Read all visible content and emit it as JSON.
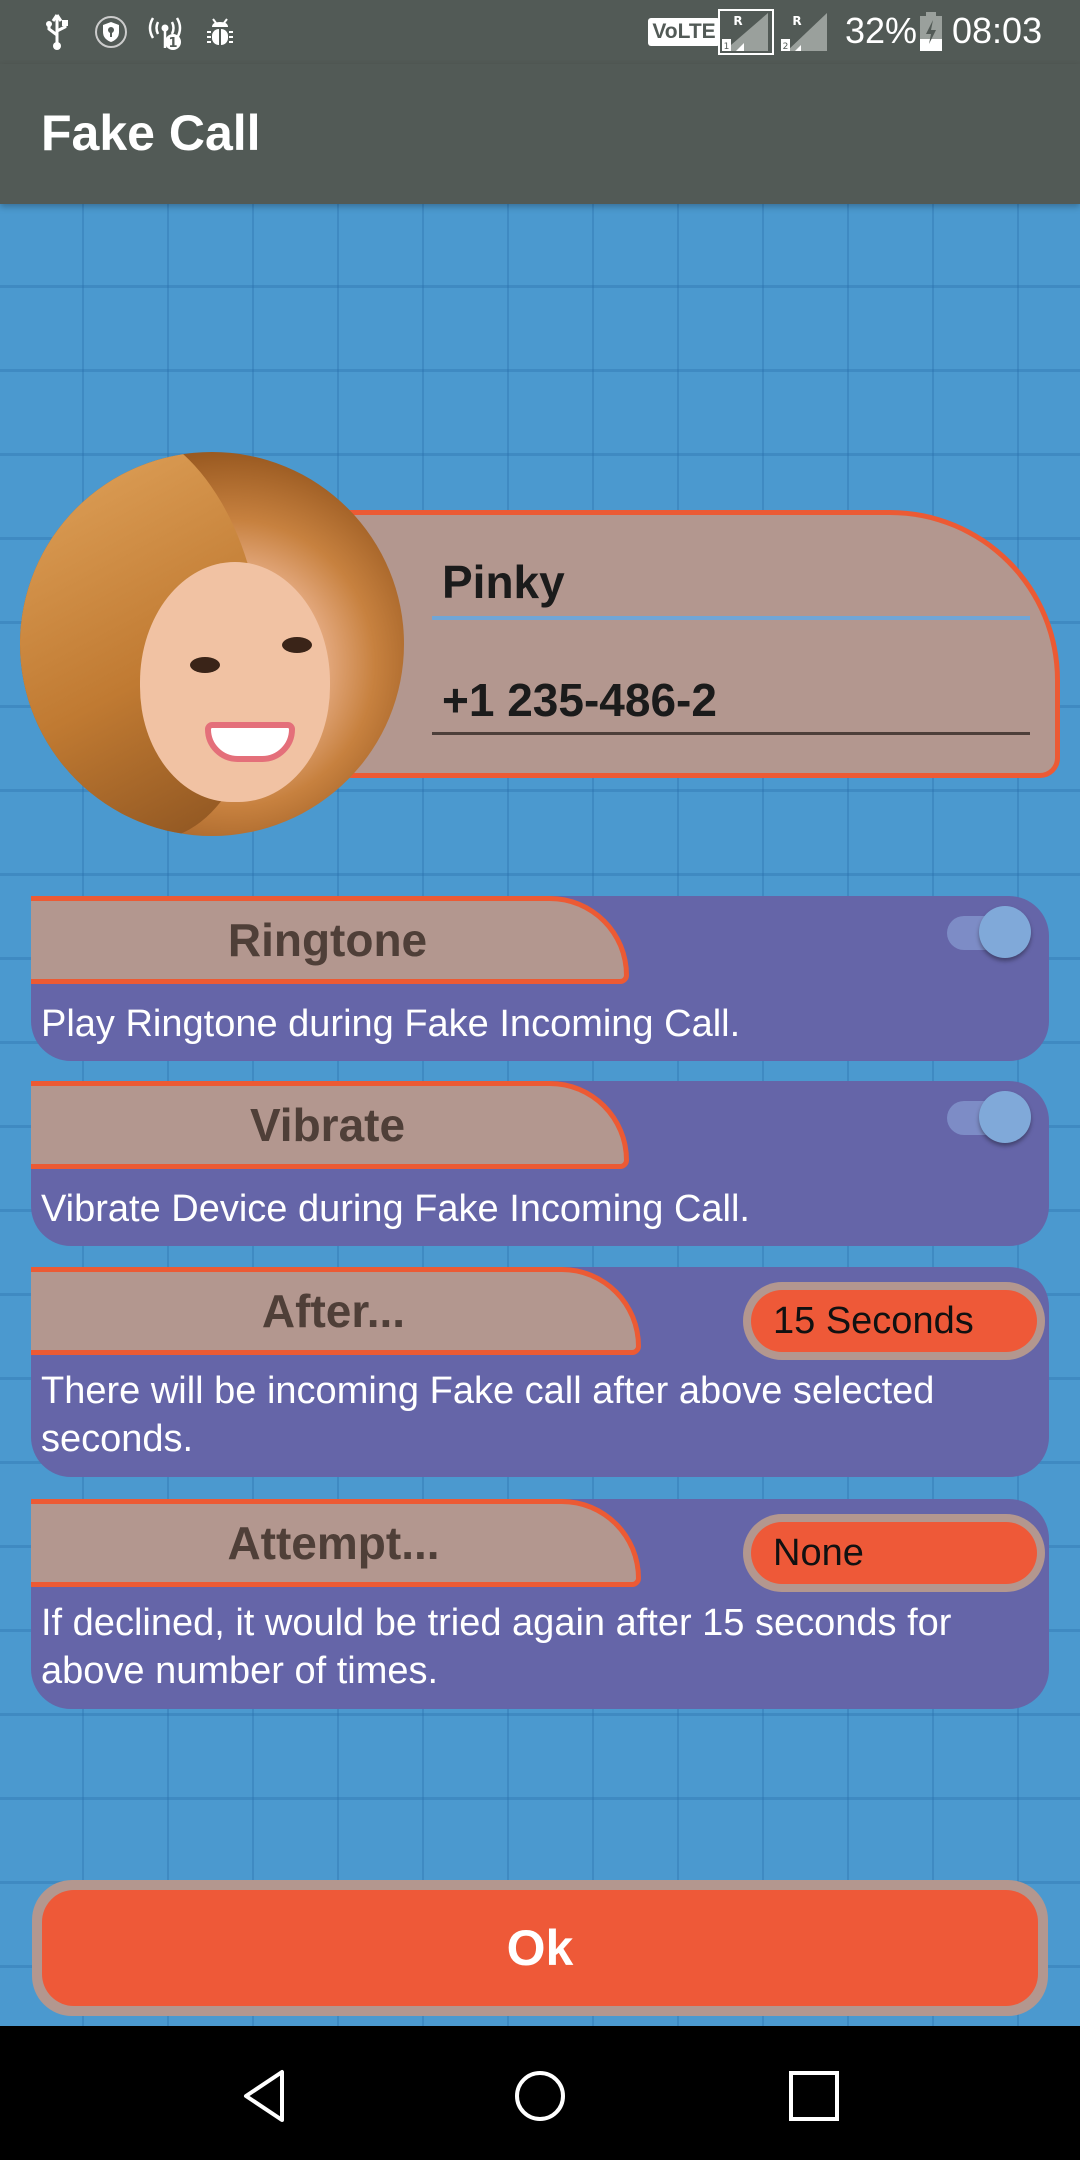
{
  "status_bar": {
    "left_icons": [
      "usb-icon",
      "vpn-shield-icon",
      "hotspot-icon",
      "debug-bug-icon"
    ],
    "volte_label": "VoLTE",
    "sim1_label": "1",
    "sim2_label": "2",
    "roaming_label": "R",
    "battery_percent": "32%",
    "battery_level": 0.32,
    "time": "08:03"
  },
  "app_bar": {
    "title": "Fake Call"
  },
  "contact": {
    "name": "Pinky",
    "phone": "+1 235-486-2"
  },
  "settings": [
    {
      "id": "ringtone",
      "title": "Ringtone",
      "description": "Play Ringtone during Fake Incoming Call.",
      "control": "toggle",
      "enabled": true
    },
    {
      "id": "vibrate",
      "title": "Vibrate",
      "description": "Vibrate Device during Fake Incoming Call.",
      "control": "toggle",
      "enabled": true
    },
    {
      "id": "after",
      "title": "After...",
      "description": "There will be incoming Fake call after above selected seconds.",
      "control": "dropdown",
      "selected": "15 Seconds"
    },
    {
      "id": "attempt",
      "title": "Attempt...",
      "description": "If declined, it would be tried again after 15 seconds for above number of times.",
      "control": "dropdown",
      "selected": "None"
    }
  ],
  "ok_button": {
    "label": "Ok"
  },
  "nav_bar": {
    "buttons": [
      "back-icon",
      "home-icon",
      "recents-icon"
    ]
  },
  "colors": {
    "toolbar": "#525a56",
    "background": "#4b99cf",
    "card": "#6565a8",
    "tab": "#b3978f",
    "accent": "#ee5938"
  }
}
